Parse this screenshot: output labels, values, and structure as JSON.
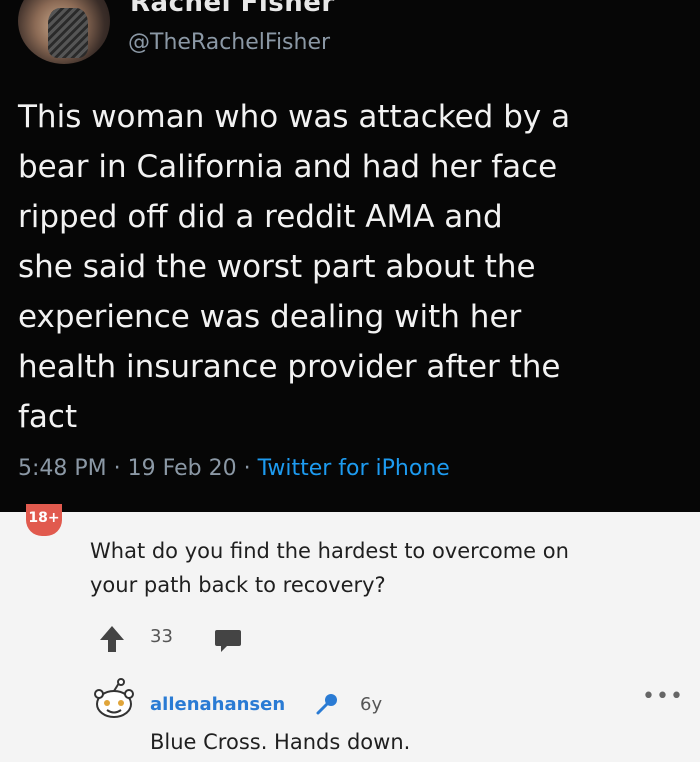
{
  "tweet": {
    "display_name": "Rachel Fisher",
    "handle": "@TheRachelFisher",
    "text_lines": [
      "This woman who was attacked by a",
      "bear in California and had her face",
      "ripped off did a reddit AMA and",
      "she said the worst part about the",
      "experience was dealing with her",
      "health insurance provider after the",
      "fact"
    ],
    "time": "5:48 PM",
    "date": "19 Feb 20",
    "separator": " · ",
    "source": "Twitter for iPhone",
    "source_color": "#1d9bf0"
  },
  "reddit": {
    "badge": "18+",
    "question_lines": [
      "What do you find the hardest to overcome on",
      "your path back to recovery?"
    ],
    "upvotes": "33",
    "reply": {
      "username": "allenahansen",
      "age": "6y",
      "text": "Blue Cross. Hands down."
    },
    "icons": {
      "upvote": "upvote-arrow-icon",
      "comment": "comment-icon",
      "avatar": "snoo-avatar-icon",
      "mic": "microphone-icon",
      "more": "more-options-icon"
    },
    "colors": {
      "username": "#2a7bd4",
      "badge": "#e15a4e"
    }
  }
}
